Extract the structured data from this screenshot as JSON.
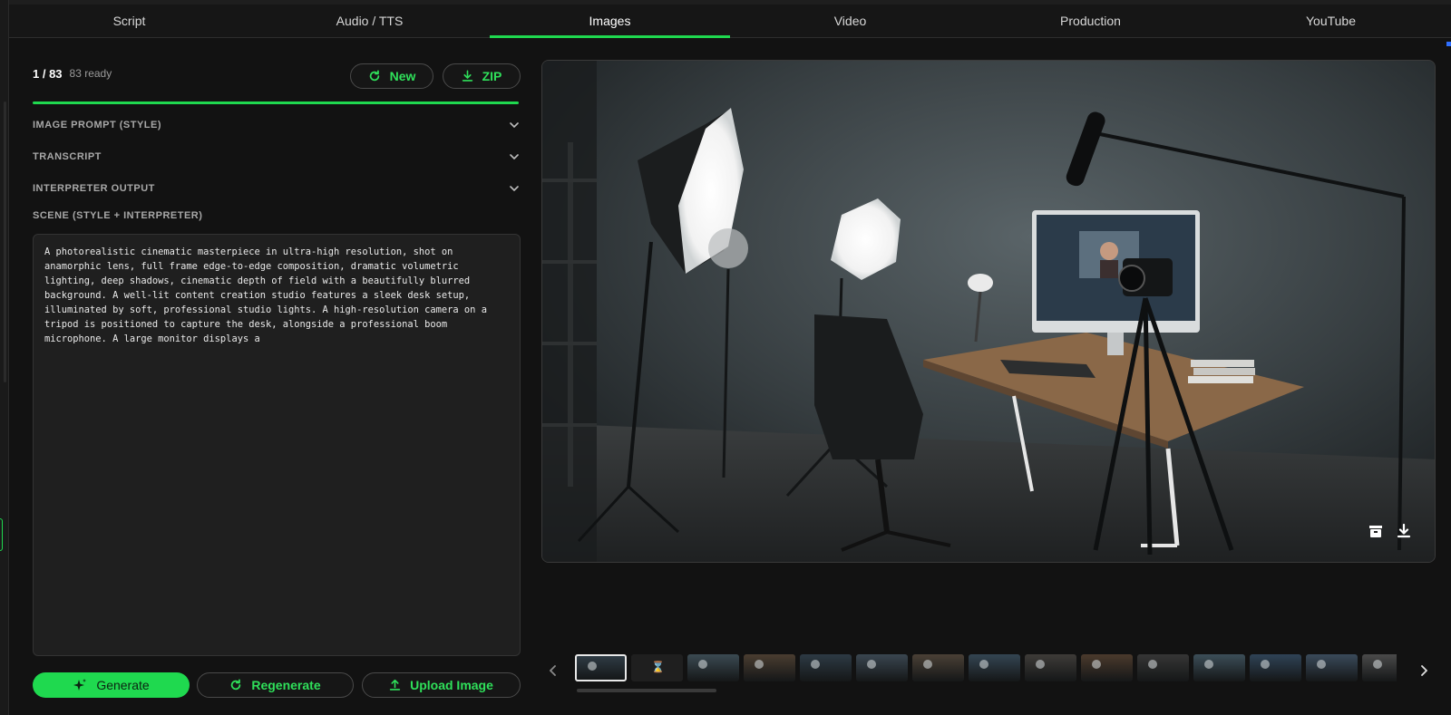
{
  "nav": {
    "tabs": [
      {
        "label": "Script",
        "active": false
      },
      {
        "label": "Audio / TTS",
        "active": false
      },
      {
        "label": "Images",
        "active": true
      },
      {
        "label": "Video",
        "active": false
      },
      {
        "label": "Production",
        "active": false
      },
      {
        "label": "YouTube",
        "active": false
      }
    ]
  },
  "images_panel": {
    "counter": "1 / 83",
    "ready_text": "83 ready",
    "new_button": "New",
    "zip_button": "ZIP",
    "progress_fraction": 1.0,
    "sections": [
      {
        "label": "IMAGE PROMPT (STYLE)",
        "icon": "chevron-down-icon"
      },
      {
        "label": "TRANSCRIPT",
        "icon": "chevron-down-icon"
      },
      {
        "label": "INTERPRETER OUTPUT",
        "icon": "chevron-down-icon"
      }
    ],
    "scene_label": "SCENE (STYLE + INTERPRETER)",
    "scene_text": "A photorealistic cinematic masterpiece in ultra-high resolution, shot on\nanamorphic lens, full frame edge-to-edge composition, dramatic volumetric\nlighting, deep shadows, cinematic depth of field with a beautifully blurred\nbackground. A well-lit content creation studio features a sleek desk setup,\nilluminated by soft, professional studio lights. A high-resolution camera on a\ntripod is positioned to capture the desk, alongside a professional boom\nmicrophone. A large monitor displays a",
    "generate_button": "Generate",
    "regenerate_button": "Regenerate",
    "upload_button": "Upload Image"
  },
  "preview": {
    "actions": [
      "archive-icon",
      "download-icon"
    ]
  },
  "filmstrip": {
    "thumbnail_count": 15,
    "selected_index": 0,
    "pending_index": 1
  },
  "colors": {
    "accent": "#1fd94f",
    "background": "#121212",
    "panel": "#1f1f1f"
  }
}
